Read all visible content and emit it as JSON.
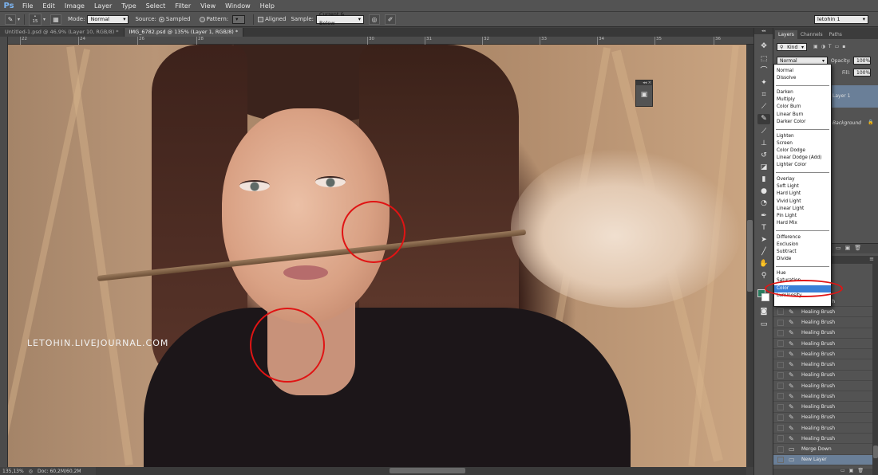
{
  "app": {
    "logo": "Ps",
    "menu": [
      "File",
      "Edit",
      "Image",
      "Layer",
      "Type",
      "Select",
      "Filter",
      "View",
      "Window",
      "Help"
    ],
    "workspace": "letohin 1"
  },
  "options_bar": {
    "brush_size": "15",
    "mode_label": "Mode:",
    "mode_value": "Normal",
    "source_label": "Source:",
    "sampled_label": "Sampled",
    "pattern_label": "Pattern:",
    "aligned_label": "Aligned",
    "sample_label": "Sample:",
    "sample_value": "Current & Below"
  },
  "doc_tabs": [
    {
      "label": "Untitled-1.psd @ 46,9% (Layer 10, RGB/8) *",
      "active": false
    },
    {
      "label": "IMG_6782.psd @ 135% (Layer 1, RGB/8) *",
      "active": true
    }
  ],
  "ruler_top": [
    "22",
    "24",
    "26",
    "28",
    "30",
    "31",
    "32",
    "33",
    "34",
    "35",
    "36"
  ],
  "canvas": {
    "watermark": "LETOHIN.LIVEJOURNAL.COM"
  },
  "status_bar": {
    "zoom": "135,13%",
    "doc": "Doc: 60,2M/60,2M"
  },
  "layers_panel": {
    "tabs": [
      "Layers",
      "Channels",
      "Paths"
    ],
    "kind_label": "Kind",
    "blend_mode": "Normal",
    "opacity_label": "Opacity:",
    "opacity_value": "100%",
    "fill_label": "Fill:",
    "fill_value": "100%",
    "layers": [
      "Layer 1",
      "Background"
    ]
  },
  "blend_dropdown": {
    "groups": [
      [
        "Normal",
        "Dissolve"
      ],
      [
        "Darken",
        "Multiply",
        "Color Burn",
        "Linear Burn",
        "Darker Color"
      ],
      [
        "Lighten",
        "Screen",
        "Color Dodge",
        "Linear Dodge (Add)",
        "Lighter Color"
      ],
      [
        "Overlay",
        "Soft Light",
        "Hard Light",
        "Vivid Light",
        "Linear Light",
        "Pin Light",
        "Hard Mix"
      ],
      [
        "Difference",
        "Exclusion",
        "Subtract",
        "Divide"
      ],
      [
        "Hue",
        "Saturation",
        "Color",
        "Luminosity"
      ]
    ],
    "selected": "Color"
  },
  "history": {
    "items": [
      "Healing Brush",
      "Healing Brush",
      "Healing Brush",
      "Healing Brush",
      "Healing Brush",
      "Healing Brush",
      "Healing Brush",
      "Healing Brush",
      "Healing Brush",
      "Healing Brush",
      "Healing Brush",
      "Healing Brush",
      "Healing Brush",
      "Healing Brush",
      "Merge Down",
      "New Layer"
    ],
    "selected_index": 15
  },
  "colors": {
    "accent_red": "#e01414",
    "selection_blue": "#3a80d8"
  }
}
